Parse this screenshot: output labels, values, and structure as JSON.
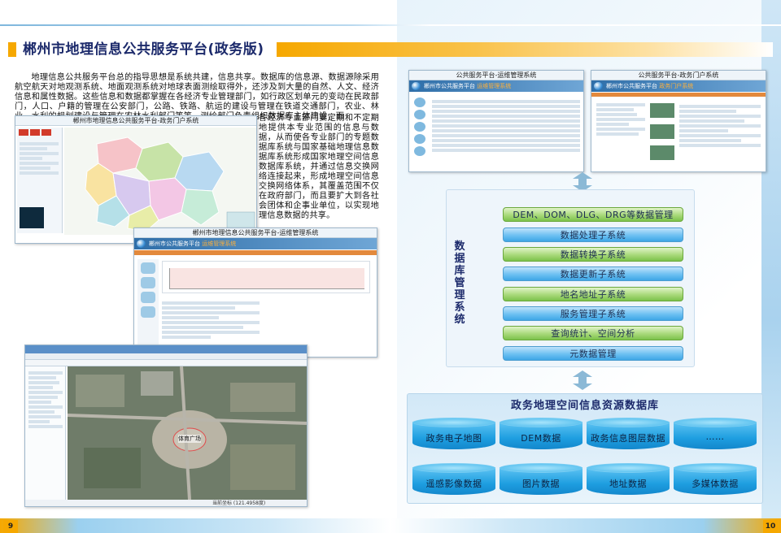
{
  "header": {
    "title": "郴州市地理信息公共服务平台(政务版)"
  },
  "intro": {
    "text_main": "地理信息公共服务平台总的指导思想是系统共建，信息共享。数据库的信息源、数据源除采用航空航天对地观测系统、地面观测系统对地球表面测绘取得外，还涉及到大量的自然、人文、经济信息和属性数据。这些信息和数据都掌握在各经济专业管理部门，如行政区划单元的变动在民政部门，人口、户籍的管理在公安部门，公路、铁路、航运的建设与管理在铁道交通部门，农业、林业、水利的规划建设与管理在农林水利部门等等。测绘部门负责组织数据库主体建设，而",
    "text_cont": "各经济专业部门要定期和不定期地提供本专业范围的信息与数据，从而使各专业部门的专题数据库系统与国家基础地理信息数据库系统形成国家地理空间信息数据库系统，并通过信息交换网络连接起来，形成地理空间信息交换网络体系，其覆盖范围不仅在政府部门，而且要扩大到各社会团体和企事业单位，以实现地理信息数据的共享。"
  },
  "screenshots": {
    "portal_left": {
      "caption": "郴州市地理信息公共服务平台-政务门户系统"
    },
    "ops_mid": {
      "caption": "郴州市地理信息公共服务平台-运维管理系统",
      "header": "郴州市公共服务平台",
      "header_sub": "运维管理系统"
    },
    "ops_right": {
      "caption": "公共服务平台-运维管理系统",
      "header": "郴州市公共服务平台",
      "header_sub": "运维管理系统"
    },
    "portal_right": {
      "caption": "公共服务平台-政务门户系统",
      "header": "郴州市公共服务平台",
      "header_sub": "政务门户系统"
    },
    "desktop": {
      "map_label": "体育广场",
      "status": "当前坐标 (121.4958度)"
    }
  },
  "db_management": {
    "vertical_title": "数据库管理系统",
    "subsystems": [
      "DEM、DOM、DLG、DRG等数据管理",
      "数据处理子系统",
      "数据转换子系统",
      "数据更新子系统",
      "地名地址子系统",
      "服务管理子系统",
      "查询统计、空间分析",
      "元数据管理"
    ]
  },
  "resource_db": {
    "title": "政务地理空间信息资源数据库",
    "items": [
      "政务电子地图",
      "DEM数据",
      "政务信息图层数据",
      "……",
      "遥感影像数据",
      "图片数据",
      "地址数据",
      "多媒体数据"
    ]
  },
  "pages": {
    "left": "9",
    "right": "10"
  },
  "colors": {
    "title_accent": "#f6a800",
    "title_text": "#1c2a6b",
    "blue_box": "#3ea6e6",
    "green_box": "#7cc24b",
    "navy_box": "#0f4f86",
    "cylinder": "#1e9ee0"
  }
}
